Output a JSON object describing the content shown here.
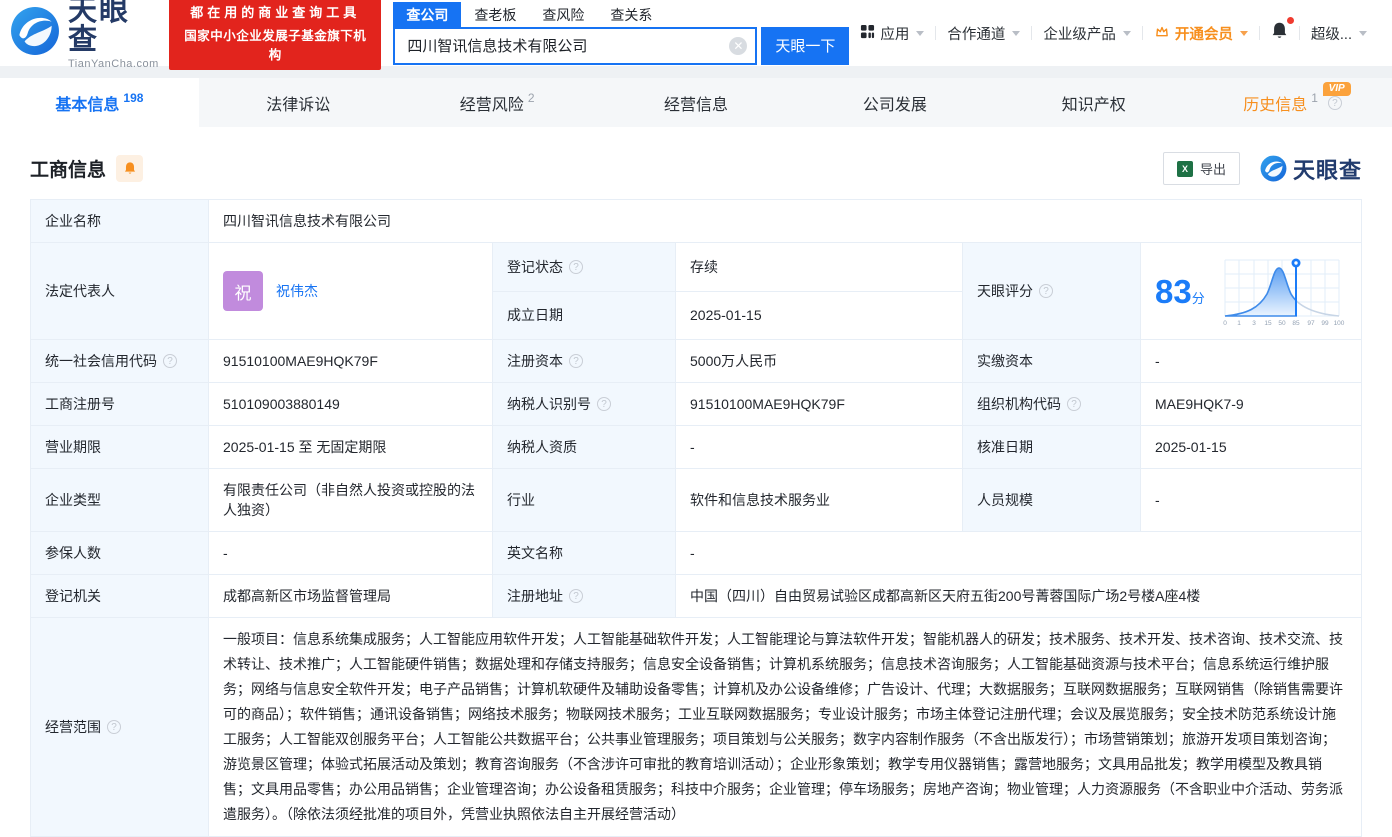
{
  "brand": {
    "name": "天眼查",
    "domain": "TianYanCha.com"
  },
  "promo": {
    "line1": "都在用的商业查询工具",
    "line2": "国家中小企业发展子基金旗下机构"
  },
  "search": {
    "tabs": [
      {
        "label": "查公司"
      },
      {
        "label": "查老板"
      },
      {
        "label": "查风险"
      },
      {
        "label": "查关系"
      }
    ],
    "value": "四川智讯信息技术有限公司",
    "button_label": "天眼一下"
  },
  "nav": {
    "apps": "应用",
    "partner": "合作通道",
    "enterprise": "企业级产品",
    "vip": "开通会员",
    "more": "超级..."
  },
  "page_tabs": [
    {
      "label": "基本信息",
      "count": "198"
    },
    {
      "label": "法律诉讼",
      "count": ""
    },
    {
      "label": "经营风险",
      "count": "2"
    },
    {
      "label": "经营信息",
      "count": ""
    },
    {
      "label": "公司发展",
      "count": ""
    },
    {
      "label": "知识产权",
      "count": ""
    },
    {
      "label": "历史信息",
      "count": "1",
      "badge": "VIP"
    }
  ],
  "section": {
    "title": "工商信息",
    "export_label": "导出",
    "brand": "天眼查"
  },
  "fields": {
    "company_name": {
      "label": "企业名称",
      "value": "四川智讯信息技术有限公司"
    },
    "legal_rep": {
      "label": "法定代表人",
      "value": "祝伟杰",
      "avatar": "祝"
    },
    "reg_status": {
      "label": "登记状态",
      "value": "存续"
    },
    "establish_date": {
      "label": "成立日期",
      "value": "2025-01-15"
    },
    "credit_code": {
      "label": "统一社会信用代码",
      "value": "91510100MAE9HQK79F"
    },
    "reg_capital": {
      "label": "注册资本",
      "value": "5000万人民币"
    },
    "paid_capital": {
      "label": "实缴资本",
      "value": "-"
    },
    "reg_number": {
      "label": "工商注册号",
      "value": "510109003880149"
    },
    "taxpayer_id": {
      "label": "纳税人识别号",
      "value": "91510100MAE9HQK79F"
    },
    "org_code": {
      "label": "组织机构代码",
      "value": "MAE9HQK7-9"
    },
    "business_term": {
      "label": "营业期限",
      "value": "2025-01-15 至 无固定期限"
    },
    "taxpayer_quality": {
      "label": "纳税人资质",
      "value": "-"
    },
    "approval_date": {
      "label": "核准日期",
      "value": "2025-01-15"
    },
    "company_type": {
      "label": "企业类型",
      "value": "有限责任公司（非自然人投资或控股的法人独资）"
    },
    "industry": {
      "label": "行业",
      "value": "软件和信息技术服务业"
    },
    "staff_size": {
      "label": "人员规模",
      "value": "-"
    },
    "insured_count": {
      "label": "参保人数",
      "value": "-"
    },
    "english_name": {
      "label": "英文名称",
      "value": "-"
    },
    "reg_authority": {
      "label": "登记机关",
      "value": "成都高新区市场监督管理局"
    },
    "reg_address": {
      "label": "注册地址",
      "value": "中国（四川）自由贸易试验区成都高新区天府五街200号菁蓉国际广场2号楼A座4楼"
    },
    "business_scope": {
      "label": "经营范围",
      "value": "一般项目：信息系统集成服务；人工智能应用软件开发；人工智能基础软件开发；人工智能理论与算法软件开发；智能机器人的研发；技术服务、技术开发、技术咨询、技术交流、技术转让、技术推广；人工智能硬件销售；数据处理和存储支持服务；信息安全设备销售；计算机系统服务；信息技术咨询服务；人工智能基础资源与技术平台；信息系统运行维护服务；网络与信息安全软件开发；电子产品销售；计算机软硬件及辅助设备零售；计算机及办公设备维修；广告设计、代理；大数据服务；互联网数据服务；互联网销售（除销售需要许可的商品）；软件销售；通讯设备销售；网络技术服务；物联网技术服务；工业互联网数据服务；专业设计服务；市场主体登记注册代理；会议及展览服务；安全技术防范系统设计施工服务；人工智能双创服务平台；人工智能公共数据平台；公共事业管理服务；项目策划与公关服务；数字内容制作服务（不含出版发行）；市场营销策划；旅游开发项目策划咨询；游览景区管理；体验式拓展活动及策划；教育咨询服务（不含涉许可审批的教育培训活动）；企业形象策划；教学专用仪器销售；露营地服务；文具用品批发；教学用模型及教具销售；文具用品零售；办公用品销售；企业管理咨询；办公设备租赁服务；科技中介服务；企业管理；停车场服务；房地产咨询；物业管理；人力资源服务（不含职业中介活动、劳务派遣服务）。（除依法须经批准的项目外，凭营业执照依法自主开展经营活动）"
    }
  },
  "score": {
    "label": "天眼评分",
    "value": "83",
    "unit": "分",
    "axis": [
      "0",
      "1",
      "3",
      "15",
      "50",
      "85",
      "97",
      "99",
      "100"
    ]
  },
  "colors": {
    "accent": "#1673F3",
    "green": "#00B34D",
    "orange": "#F78F1E",
    "red": "#E2241D",
    "label_bg": "#F2F8FE"
  }
}
